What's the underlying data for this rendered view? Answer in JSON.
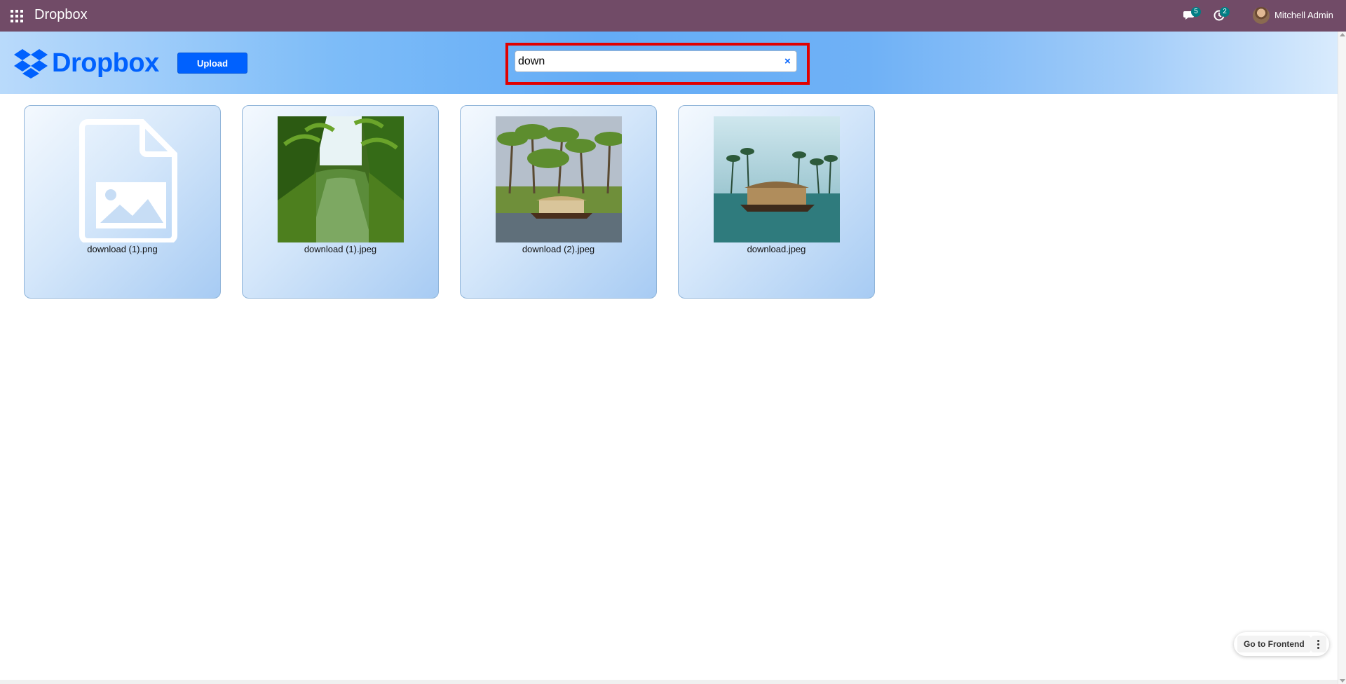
{
  "navbar": {
    "brand": "Dropbox",
    "messages_count": "5",
    "activities_count": "2",
    "user_name": "Mitchell Admin"
  },
  "header": {
    "wordmark": "Dropbox",
    "upload_label": "Upload",
    "search_value": "down",
    "clear_icon": "×"
  },
  "files": [
    {
      "name": "download (1).png",
      "thumbnail": "image-placeholder-icon"
    },
    {
      "name": "download (1).jpeg",
      "thumbnail": "palm-canal-photo"
    },
    {
      "name": "download (2).jpeg",
      "thumbnail": "houseboat-palms-photo"
    },
    {
      "name": "download.jpeg",
      "thumbnail": "houseboat-lagoon-photo"
    }
  ],
  "footer": {
    "frontend_label": "Go to Frontend"
  },
  "colors": {
    "navbar": "#714B67",
    "dropbox_blue": "#0061FE",
    "highlight_red": "#e00000",
    "badge": "#017e84"
  }
}
